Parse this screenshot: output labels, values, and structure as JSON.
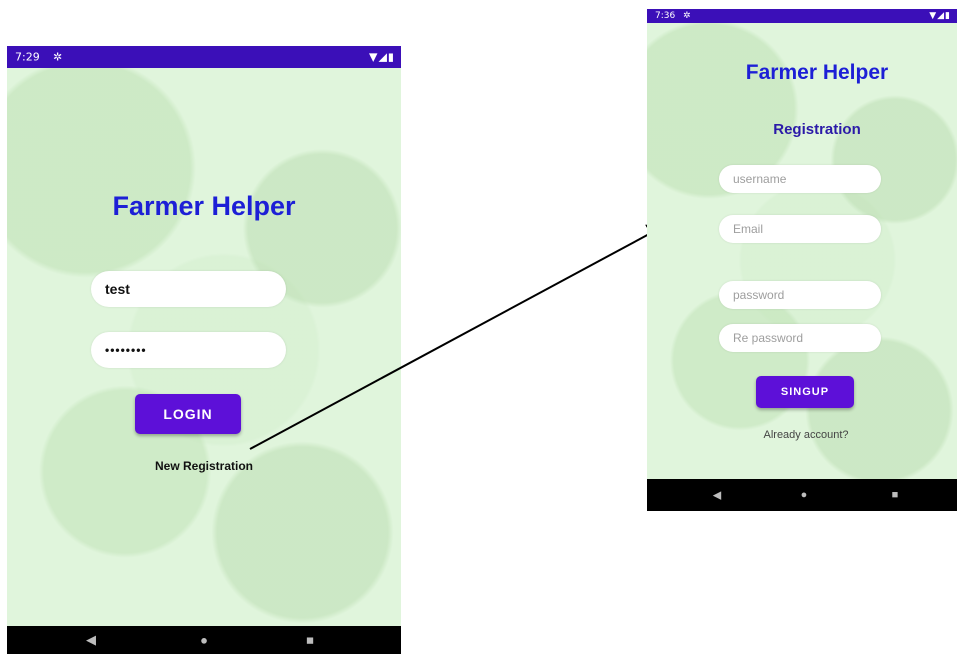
{
  "login": {
    "status_time": "7:29",
    "app_title": "Farmer Helper",
    "username_value": "test",
    "password_value": "••••••••",
    "login_label": "LOGIN",
    "new_registration_label": "New Registration"
  },
  "register": {
    "status_time": "7:36",
    "app_title": "Farmer Helper",
    "heading": "Registration",
    "username_placeholder": "username",
    "email_placeholder": "Email",
    "password_placeholder": "password",
    "repassword_placeholder": "Re password",
    "signup_label": "SINGUP",
    "already_account_label": "Already account?"
  },
  "icons": {
    "settings": "gear-icon",
    "wifi": "wifi-icon",
    "signal": "signal-icon",
    "battery": "battery-icon",
    "back": "back-triangle-icon",
    "home": "home-circle-icon",
    "recents": "recents-square-icon"
  },
  "colors": {
    "status_bar": "#3b0fb8",
    "title": "#1d1fd6",
    "button": "#5d10d8",
    "background": "#e0f5dc",
    "nav_bar": "#000000"
  }
}
